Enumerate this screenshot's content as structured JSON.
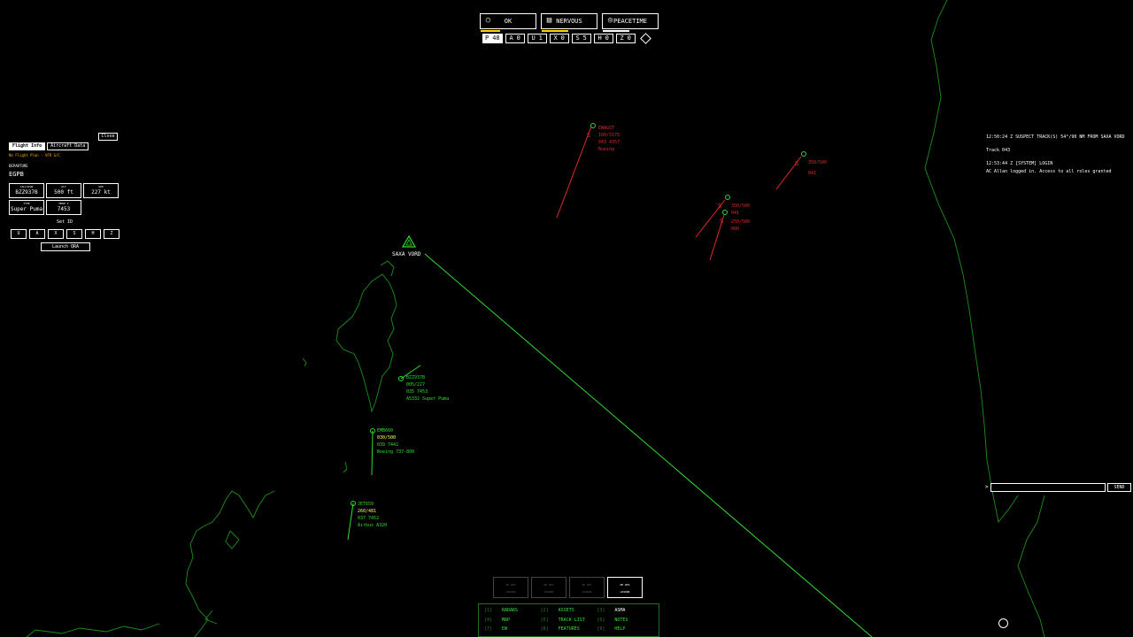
{
  "status": {
    "items": [
      {
        "label": "OK",
        "icon": "person-icon"
      },
      {
        "label": "NERVOUS",
        "icon": "keyboard-icon"
      },
      {
        "label": "PEACETIME",
        "icon": "globe-icon"
      }
    ]
  },
  "counters": [
    {
      "key": "P",
      "value": "48",
      "active": true
    },
    {
      "key": "A",
      "value": "0"
    },
    {
      "key": "U",
      "value": "1"
    },
    {
      "key": "X",
      "value": "0"
    },
    {
      "key": "S",
      "value": "5"
    },
    {
      "key": "H",
      "value": "0"
    },
    {
      "key": "Z",
      "value": "0"
    }
  ],
  "panel": {
    "close": "Close",
    "tabs": [
      "Flight Info",
      "Aircraft Data"
    ],
    "flight_plan_note": "No Flight Plan - VFR G/C",
    "departure_label": "DEPARTURE",
    "departure_value": "EGPB",
    "cells": [
      {
        "label": "CALLSIGN",
        "value": "BZZ937B"
      },
      {
        "label": "ALT",
        "value": "500 ft"
      },
      {
        "label": "SPD",
        "value": "227 kt"
      },
      {
        "label": "TYPE",
        "value": "Super Puma"
      },
      {
        "label": "MODE 3",
        "value": "7453"
      }
    ],
    "set_id_label": "Set ID",
    "id_buttons": [
      "U",
      "A",
      "X",
      "S",
      "H",
      "Z"
    ],
    "launch_qra": "Launch QRA"
  },
  "log": {
    "line1": "12:50:24 Z  SUSPECT TRACK(S) 54°/90 NM FROM SAXA VORD",
    "line2": "Track 043",
    "line3": "12:53:44 Z [SYSTEM]  LOGIN",
    "line4": "AC Allan logged in. Access to all roles granted"
  },
  "chat": {
    "prompt": ">",
    "send": "SEND"
  },
  "mode_buttons": [
    {
      "title": "RH WFD",
      "sub": "LEGEND"
    },
    {
      "title": "RH WFD",
      "sub": "LEGEND"
    },
    {
      "title": "RH WFD",
      "sub": "LEGEND"
    },
    {
      "title": "RH WFD",
      "sub": "LEGEND",
      "active": true
    }
  ],
  "menu": [
    {
      "key": "[1]",
      "label": "RADARS"
    },
    {
      "key": "[2]",
      "label": "ASSETS"
    },
    {
      "key": "[3]",
      "label": "ASMA",
      "active": true
    },
    {
      "key": "[4]",
      "label": "MAP"
    },
    {
      "key": "[5]",
      "label": "TRACK LIST"
    },
    {
      "key": "[6]",
      "label": "NOTES"
    },
    {
      "key": "[7]",
      "label": "EW"
    },
    {
      "key": "[8]",
      "label": "FEATURES"
    },
    {
      "key": "[9]",
      "label": "HELP"
    }
  ],
  "radar": {
    "station": "SAXA VORD",
    "tracks_friendly": [
      {
        "callsign": "BZZ937B",
        "l2": "005/227",
        "l3": "035 7453",
        "l4": "A5332 Super Puma"
      },
      {
        "callsign": "EMB660",
        "l2": "030/500",
        "l3": "039 7442",
        "l4": "Boeing 737-800"
      },
      {
        "callsign": "JET659",
        "l2": "260/481",
        "l3": "037 7452",
        "l4": "Airbus A320"
      }
    ],
    "tracks_suspect": [
      {
        "callsign": "EWAGST",
        "l2": "100/3175",
        "l3": "043 4357",
        "l4": "Boeing"
      },
      {
        "callsign": "350/500",
        "l2": "041",
        "l3": "",
        "l4": ""
      },
      {
        "callsign": "350/500",
        "l2": "041",
        "l3": "",
        "l4": ""
      },
      {
        "callsign": "250/500",
        "l2": "000",
        "l3": "",
        "l4": ""
      }
    ],
    "suspect_marker": "S",
    "colors": {
      "friendly": "#2fdc2f",
      "suspect": "#e02a2a",
      "coast": "#1c8f1c"
    }
  }
}
